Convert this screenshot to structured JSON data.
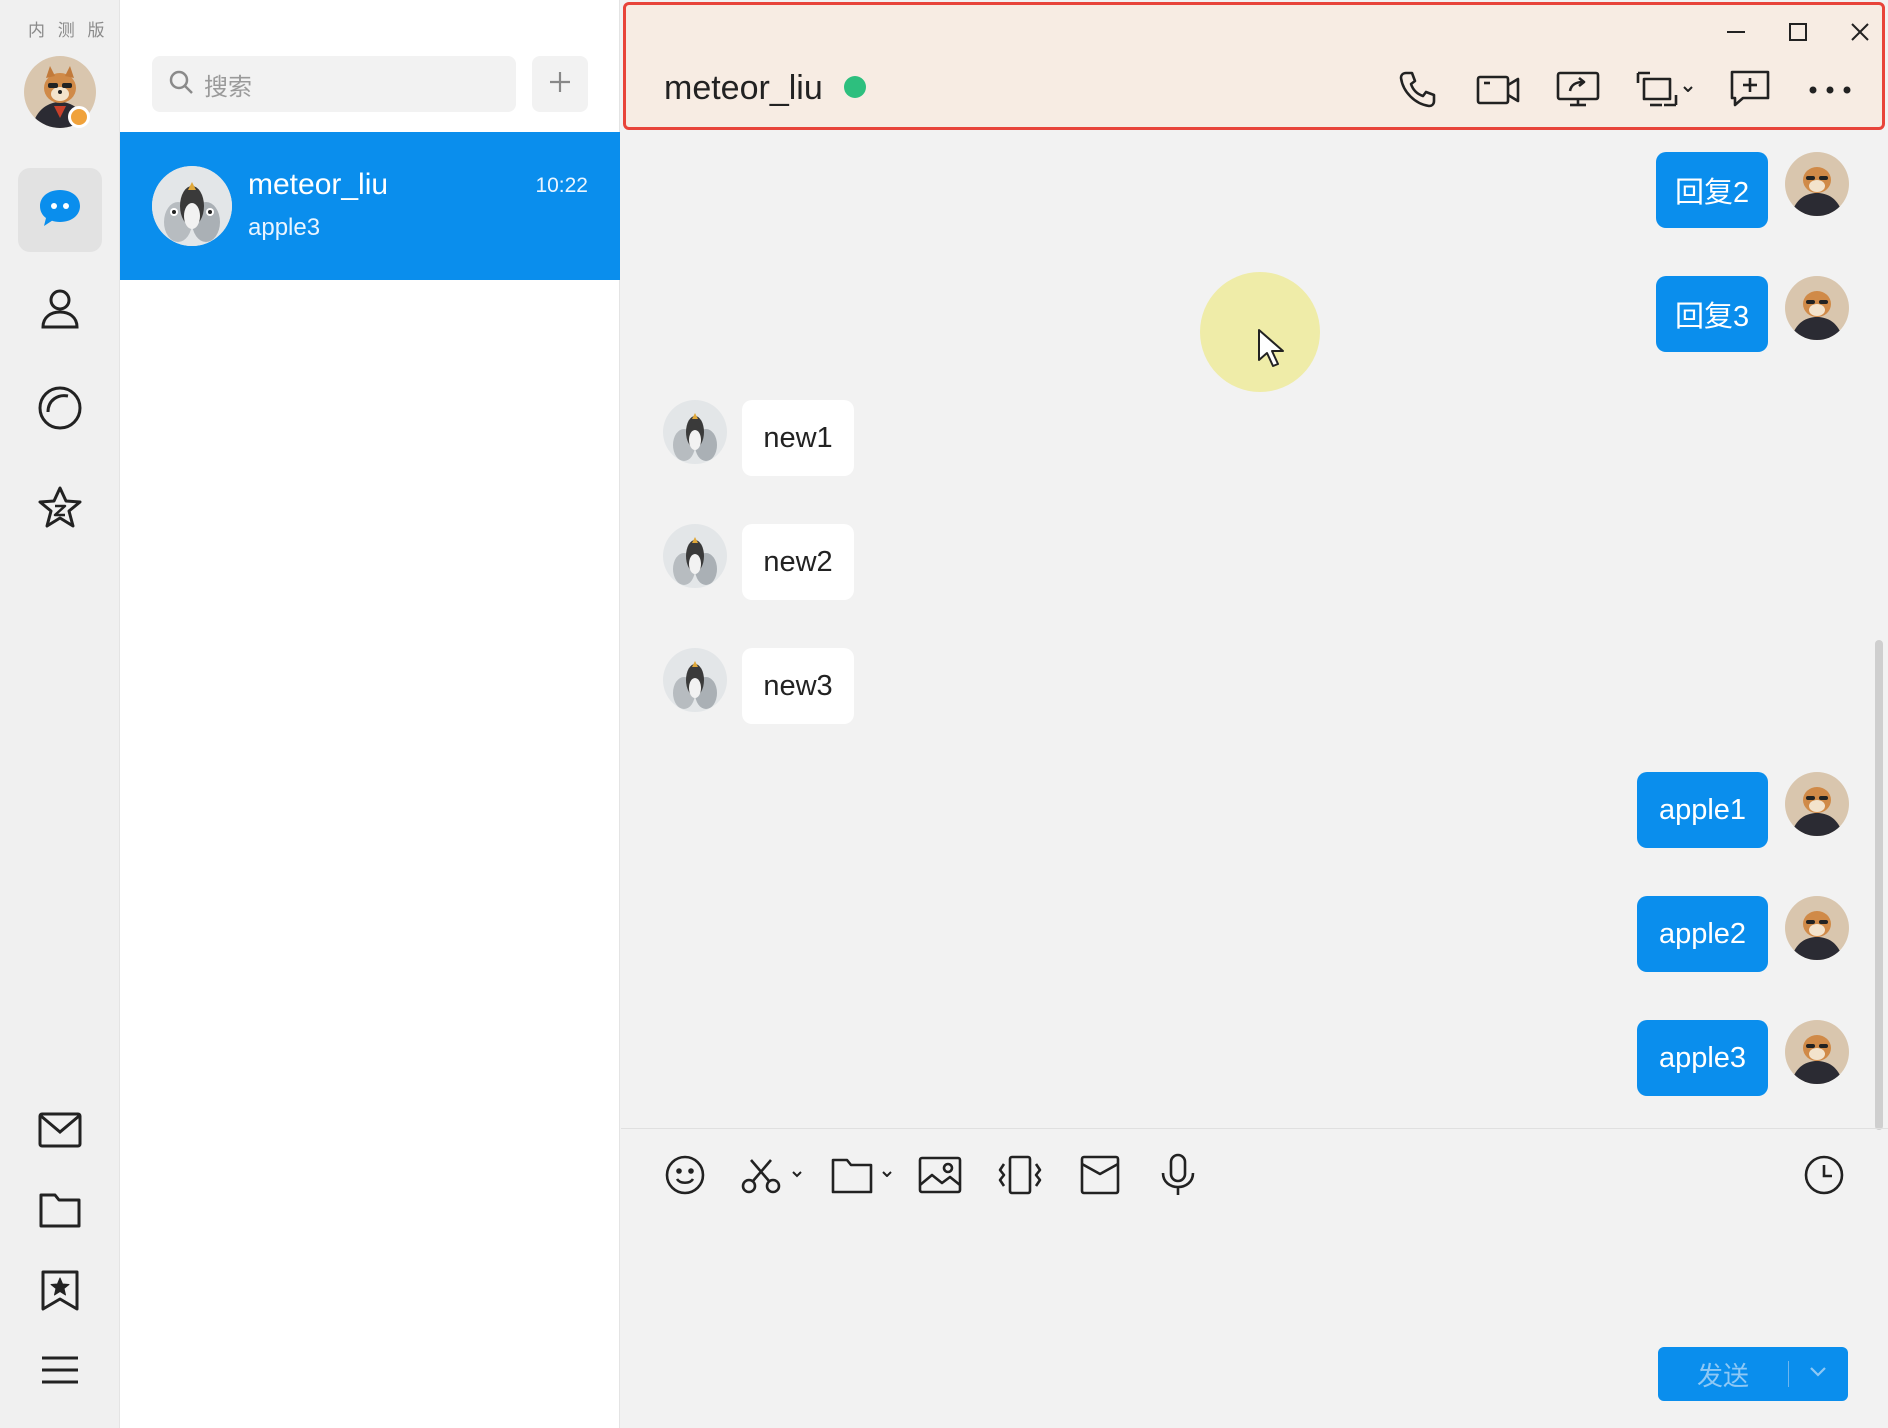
{
  "app": {
    "beta_label": "内 测 版"
  },
  "rail": {
    "items": [
      {
        "name": "messages",
        "icon": "chat-bubble-icon",
        "active": true
      },
      {
        "name": "contacts",
        "icon": "person-icon",
        "active": false
      },
      {
        "name": "moments",
        "icon": "circle-icon",
        "active": false
      },
      {
        "name": "favorites",
        "icon": "star-z-icon",
        "active": false
      }
    ],
    "bottom_items": [
      {
        "name": "mail",
        "icon": "mail-icon"
      },
      {
        "name": "files",
        "icon": "folder-icon"
      },
      {
        "name": "bookmarks",
        "icon": "bookmark-star-icon"
      },
      {
        "name": "menu",
        "icon": "hamburger-icon"
      }
    ]
  },
  "list": {
    "search_placeholder": "搜索",
    "conversations": [
      {
        "name": "meteor_liu",
        "preview": "apple3",
        "time": "10:22",
        "selected": true
      }
    ]
  },
  "chat": {
    "title": "meteor_liu",
    "status_color": "#2dbf7e",
    "messages": [
      {
        "direction": "out",
        "text": "回复2"
      },
      {
        "direction": "out",
        "text": "回复3"
      },
      {
        "direction": "in",
        "text": "new1"
      },
      {
        "direction": "in",
        "text": "new2"
      },
      {
        "direction": "in",
        "text": "new3"
      },
      {
        "direction": "out",
        "text": "apple1"
      },
      {
        "direction": "out",
        "text": "apple2"
      },
      {
        "direction": "out",
        "text": "apple3"
      }
    ],
    "send_label": "发送"
  },
  "colors": {
    "accent": "#0a8eed",
    "header_border": "#e8443a",
    "header_bg": "#f7ece3"
  }
}
